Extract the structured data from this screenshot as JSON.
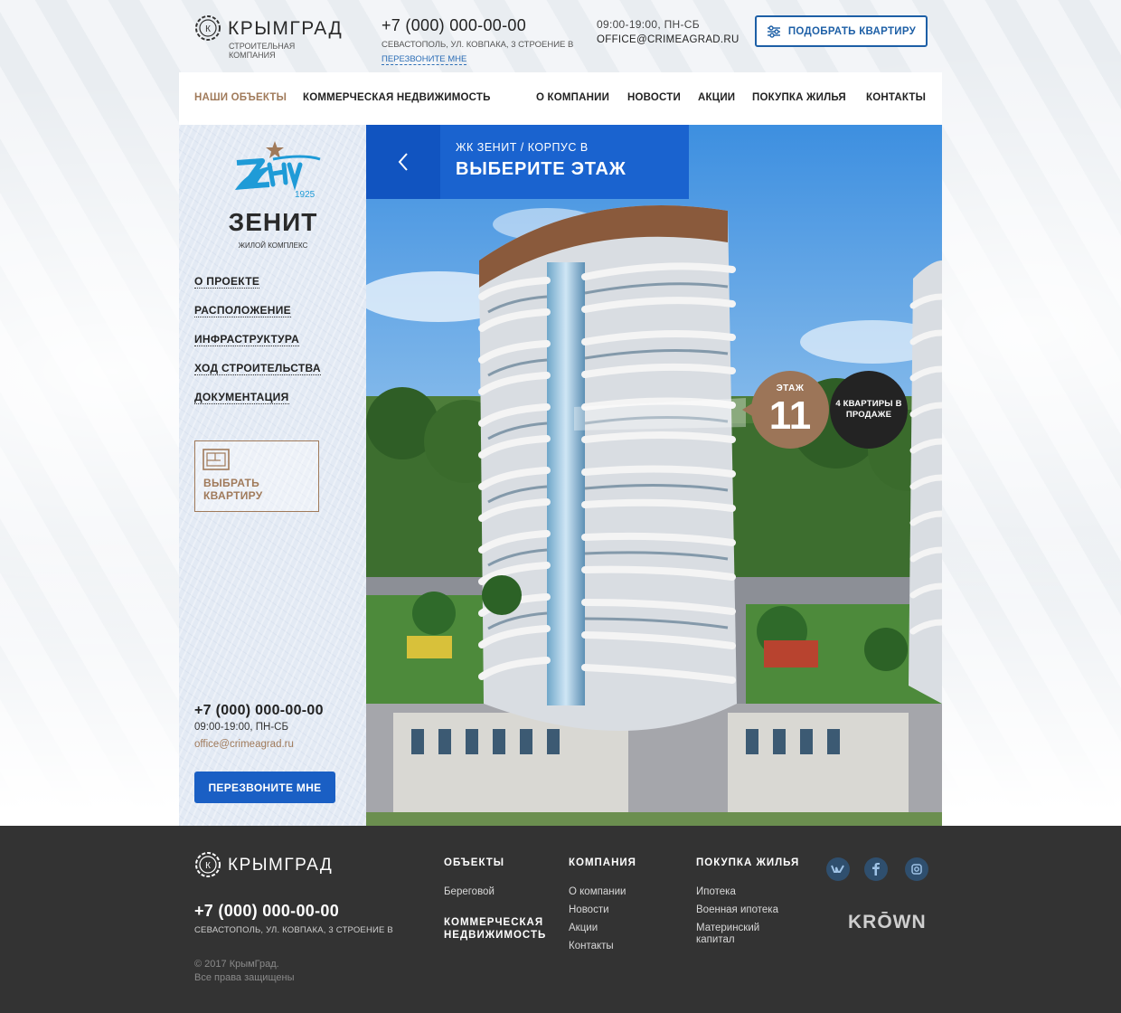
{
  "brand": {
    "name": "КРЫМГРАД",
    "tagline": "СТРОИТЕЛЬНАЯ КОМПАНИЯ"
  },
  "header": {
    "phone": "+7 (000) 000-00-00",
    "address": "СЕВАСТОПОЛЬ, УЛ. КОВПАКА, 3 СТРОЕНИЕ В",
    "callback_link": "ПЕРЕЗВОНИТЕ МНЕ",
    "hours": "09:00-19:00, ПН-СБ",
    "email": "OFFICE@CRIMEAGRAD.RU",
    "pick_button": "ПОДОБРАТЬ КВАРТИРУ"
  },
  "nav": {
    "items": [
      "НАШИ ОБЪЕКТЫ",
      "КОММЕРЧЕСКАЯ НЕДВИЖИМОСТЬ",
      "О КОМПАНИИ",
      "НОВОСТИ",
      "АКЦИИ",
      "ПОКУПКА ЖИЛЬЯ",
      "КОНТАКТЫ"
    ],
    "active_index": 0
  },
  "sidebar": {
    "project_logo_year": "1925",
    "project_name": "ЗЕНИТ",
    "project_subtitle": "ЖИЛОЙ КОМПЛЕКС",
    "menu": [
      "О ПРОЕКТЕ",
      "РАСПОЛОЖЕНИЕ",
      "ИНФРАСТРУКТУРА",
      "ХОД СТРОИТЕЛЬСТВА",
      "ДОКУМЕНТАЦИЯ"
    ],
    "choose_flat": "ВЫБРАТЬ КВАРТИРУ",
    "phone": "+7 (000) 000-00-00",
    "hours": "09:00-19:00, ПН-СБ",
    "email": "office@crimeagrad.ru",
    "callback_button": "ПЕРЕЗВОНИТЕ МНЕ"
  },
  "hero": {
    "breadcrumb": "ЖК ЗЕНИТ / КОРПУС В",
    "title": "ВЫБЕРИТЕ ЭТАЖ",
    "floor_label": "ЭТАЖ",
    "floor_number": "11",
    "flats_on_sale": "4 КВАРТИРЫ В ПРОДАЖЕ"
  },
  "footer": {
    "phone": "+7 (000) 000-00-00",
    "address": "СЕВАСТОПОЛЬ, УЛ. КОВПАКА, 3 СТРОЕНИЕ В",
    "copyright": "© 2017 КрымГрад.",
    "rights": "Все права защищены",
    "col_objects": {
      "title": "ОБЪЕКТЫ",
      "links": [
        "Береговой"
      ],
      "title2": "КОММЕРЧЕСКАЯ НЕДВИЖИМОСТЬ"
    },
    "col_company": {
      "title": "КОМПАНИЯ",
      "links": [
        "О компании",
        "Новости",
        "Акции",
        "Контакты"
      ]
    },
    "col_buy": {
      "title": "ПОКУПКА ЖИЛЬЯ",
      "links": [
        "Ипотека",
        "Военная ипотека",
        "Материнский капитал"
      ]
    },
    "social": [
      "vk-icon",
      "facebook-icon",
      "instagram-icon"
    ],
    "developer": "KRŌWN"
  },
  "colors": {
    "accent_blue": "#1a63cf",
    "accent_brown": "#9c7558",
    "footer_bg": "#333333"
  }
}
